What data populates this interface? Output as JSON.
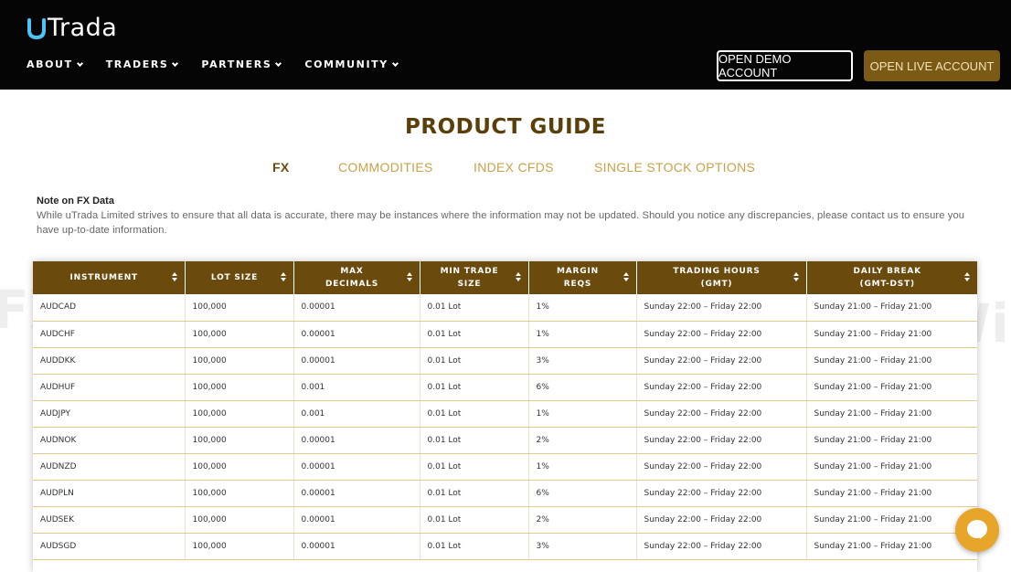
{
  "header": {
    "logo_text": "Trada",
    "nav": [
      {
        "label": "ABOUT"
      },
      {
        "label": "TRADERS"
      },
      {
        "label": "PARTNERS"
      },
      {
        "label": "COMMUNITY"
      }
    ],
    "demo_button": "OPEN DEMO ACCOUNT",
    "live_button": "OPEN LIVE ACCOUNT"
  },
  "page_title": "PRODUCT GUIDE",
  "tabs": [
    {
      "label": "FX",
      "active": true
    },
    {
      "label": "COMMODITIES",
      "active": false
    },
    {
      "label": "INDEX CFDS",
      "active": false
    },
    {
      "label": "SINGLE STOCK OPTIONS",
      "active": false
    }
  ],
  "note": {
    "title": "Note on FX Data",
    "text": "While uTrada Limited strives to ensure that all data is accurate, there may be instances where the information may not be updated. Should you notice any discrepancies, please contact us to ensure you have up-to-date information."
  },
  "table": {
    "headers": [
      {
        "line1": "INSTRUMENT",
        "line2": ""
      },
      {
        "line1": "LOT SIZE",
        "line2": ""
      },
      {
        "line1": "MAX",
        "line2": "DECIMALS"
      },
      {
        "line1": "MIN TRADE",
        "line2": "SIZE"
      },
      {
        "line1": "MARGIN",
        "line2": "REQS"
      },
      {
        "line1": "TRADING HOURS",
        "line2": "(GMT)"
      },
      {
        "line1": "DAILY BREAK",
        "line2": "(GMT-DST)"
      }
    ],
    "rows": [
      [
        "AUDCAD",
        "100,000",
        "0.00001",
        "0.01 Lot",
        "1%",
        "Sunday 22:00 – Friday 22:00",
        "Sunday 21:00 – Friday 21:00"
      ],
      [
        "AUDCHF",
        "100,000",
        "0.00001",
        "0.01 Lot",
        "1%",
        "Sunday 22:00 – Friday 22:00",
        "Sunday 21:00 – Friday 21:00"
      ],
      [
        "AUDDKK",
        "100,000",
        "0.00001",
        "0.01 Lot",
        "3%",
        "Sunday 22:00 – Friday 22:00",
        "Sunday 21:00 – Friday 21:00"
      ],
      [
        "AUDHUF",
        "100,000",
        "0.001",
        "0.01 Lot",
        "6%",
        "Sunday 22:00 – Friday 22:00",
        "Sunday 21:00 – Friday 21:00"
      ],
      [
        "AUDJPY",
        "100,000",
        "0.001",
        "0.01 Lot",
        "1%",
        "Sunday 22:00 – Friday 22:00",
        "Sunday 21:00 – Friday 21:00"
      ],
      [
        "AUDNOK",
        "100,000",
        "0.00001",
        "0.01 Lot",
        "2%",
        "Sunday 22:00 – Friday 22:00",
        "Sunday 21:00 – Friday 21:00"
      ],
      [
        "AUDNZD",
        "100,000",
        "0.00001",
        "0.01 Lot",
        "1%",
        "Sunday 22:00 – Friday 22:00",
        "Sunday 21:00 – Friday 21:00"
      ],
      [
        "AUDPLN",
        "100,000",
        "0.00001",
        "0.01 Lot",
        "6%",
        "Sunday 22:00 – Friday 22:00",
        "Sunday 21:00 – Friday 21:00"
      ],
      [
        "AUDSEK",
        "100,000",
        "0.00001",
        "0.01 Lot",
        "2%",
        "Sunday 22:00 – Friday 22:00",
        "Sunday 21:00 – Friday 21:00"
      ],
      [
        "AUDSGD",
        "100,000",
        "0.00001",
        "0.01 Lot",
        "3%",
        "Sunday 22:00 – Friday 22:00",
        "Sunday 21:00 – Friday 21:00"
      ]
    ]
  },
  "watermark": [
    "WikiFX",
    "FX",
    "WikiFX"
  ],
  "colors": {
    "header_bg": "#050505",
    "brand_gold": "#6b4a0d",
    "tab_gold": "#c9a14a",
    "live_button_bg": "#7a5a14",
    "chat_orange": "#e7a52a",
    "logo_accent": "#4fc3f7"
  }
}
